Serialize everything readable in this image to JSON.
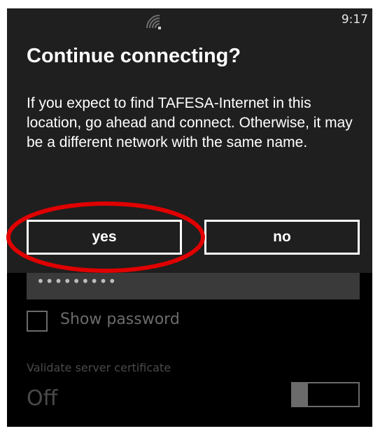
{
  "status_bar": {
    "time": "9:17",
    "wifi_icon": "wifi-signal-icon"
  },
  "dialog": {
    "title": "Continue connecting?",
    "message": "If you expect to find TAFESA-Internet in this location, go ahead and connect. Otherwise, it may be a different network with the same name.",
    "buttons": {
      "yes_label": "yes",
      "no_label": "no"
    }
  },
  "background_settings": {
    "password_masked": "•••••••••",
    "show_password_label": "Show password",
    "show_password_checked": false,
    "validate_server_certificate_label": "Validate server certificate",
    "validate_server_certificate_value": "Off"
  },
  "annotation": {
    "shape": "ellipse",
    "color": "#e00000",
    "target": "yes-button"
  }
}
